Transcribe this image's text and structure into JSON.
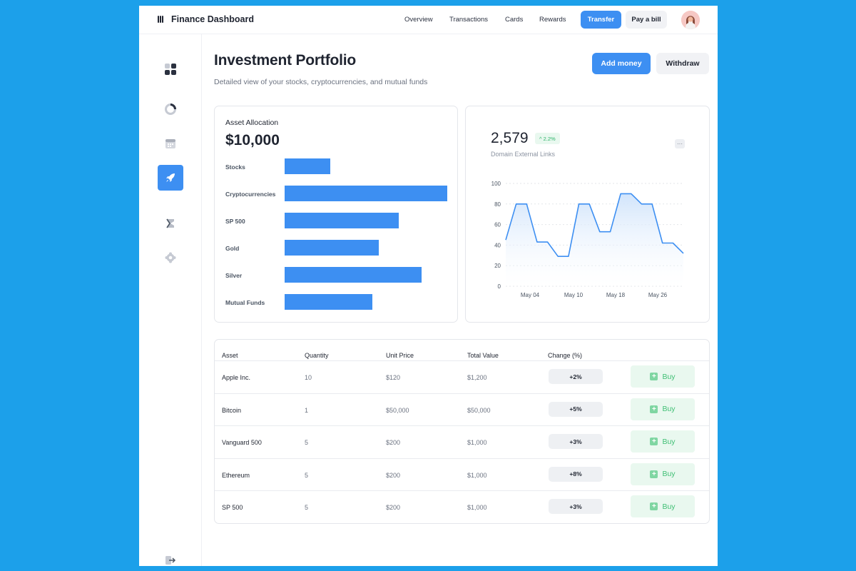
{
  "app": {
    "title": "Finance Dashboard"
  },
  "nav": {
    "items": [
      "Overview",
      "Transactions",
      "Cards",
      "Rewards"
    ],
    "transfer_label": "Transfer",
    "paybill_label": "Pay a bill"
  },
  "sidebar": {
    "icons": [
      "dashboard-icon",
      "pie-chart-icon",
      "calendar-icon",
      "rocket-icon",
      "sigma-icon",
      "settings-icon"
    ],
    "active": "rocket-icon",
    "logout_icon": "logout-icon"
  },
  "page": {
    "title": "Investment Portfolio",
    "subtitle": "Detailed view of your stocks, cryptocurrencies, and mutual funds",
    "add_money_label": "Add money",
    "withdraw_label": "Withdraw"
  },
  "allocation": {
    "title": "Asset Allocation",
    "total": "$10,000"
  },
  "metric": {
    "value": "2,579",
    "badge": "^ 2.2%",
    "label": "Domain External Links",
    "more": "···"
  },
  "chart_data": [
    {
      "type": "bar",
      "title": "Asset Allocation",
      "orientation": "horizontal",
      "categories": [
        "Stocks",
        "Cryptocurrencies",
        "SP 500",
        "Gold",
        "Silver",
        "Mutual Funds"
      ],
      "values": [
        28,
        100,
        70,
        58,
        84,
        54
      ],
      "grid": false,
      "color": "#3d8ff2"
    },
    {
      "type": "area",
      "title": "",
      "x_ticks": [
        "May 04",
        "May 10",
        "May 18",
        "May 26"
      ],
      "y_ticks": [
        0,
        20,
        40,
        60,
        80,
        100
      ],
      "ylim": [
        0,
        100
      ],
      "series": [
        {
          "values": [
            45,
            80,
            80,
            43,
            43,
            29,
            29,
            80,
            80,
            53,
            53,
            90,
            90,
            80,
            80,
            42,
            42,
            32
          ]
        }
      ],
      "grid": true,
      "color": "#3d8ff2"
    }
  ],
  "table": {
    "headers": [
      "Asset",
      "Quantity",
      "Unit Price",
      "Total Value",
      "Change (%)"
    ],
    "buy_label": "Buy",
    "rows": [
      {
        "asset": "Apple Inc.",
        "quantity": "10",
        "unit_price": "$120",
        "total": "$1,200",
        "change": "+2%"
      },
      {
        "asset": "Bitcoin",
        "quantity": "1",
        "unit_price": "$50,000",
        "total": "$50,000",
        "change": "+5%"
      },
      {
        "asset": "Vanguard 500",
        "quantity": "5",
        "unit_price": "$200",
        "total": "$1,000",
        "change": "+3%"
      },
      {
        "asset": "Ethereum",
        "quantity": "5",
        "unit_price": "$200",
        "total": "$1,000",
        "change": "+8%"
      },
      {
        "asset": "SP 500",
        "quantity": "5",
        "unit_price": "$200",
        "total": "$1,000",
        "change": "+3%"
      }
    ]
  },
  "colors": {
    "background": "#1ca0ea",
    "accent": "#3d8ff2",
    "success": "#3fbf74"
  }
}
